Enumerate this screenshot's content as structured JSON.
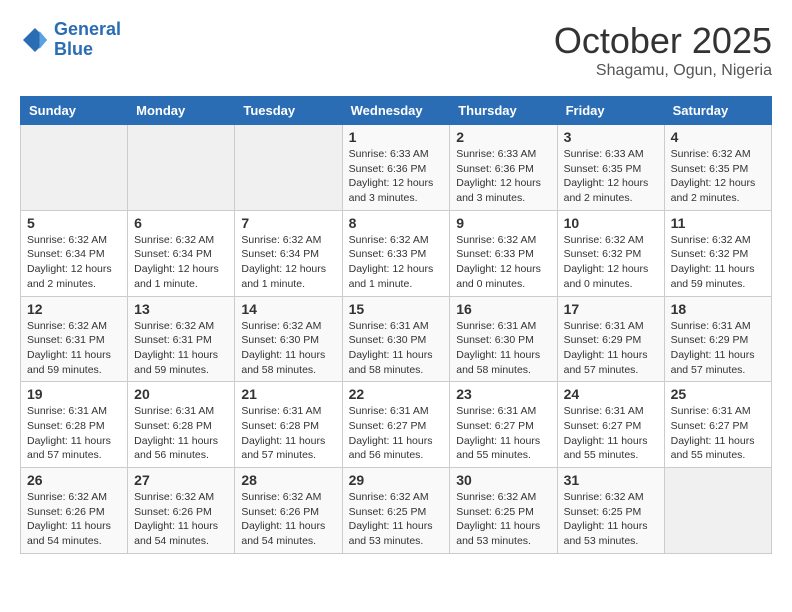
{
  "header": {
    "logo_line1": "General",
    "logo_line2": "Blue",
    "month": "October 2025",
    "location": "Shagamu, Ogun, Nigeria"
  },
  "days_of_week": [
    "Sunday",
    "Monday",
    "Tuesday",
    "Wednesday",
    "Thursday",
    "Friday",
    "Saturday"
  ],
  "weeks": [
    [
      {
        "num": "",
        "info": ""
      },
      {
        "num": "",
        "info": ""
      },
      {
        "num": "",
        "info": ""
      },
      {
        "num": "1",
        "info": "Sunrise: 6:33 AM\nSunset: 6:36 PM\nDaylight: 12 hours and 3 minutes."
      },
      {
        "num": "2",
        "info": "Sunrise: 6:33 AM\nSunset: 6:36 PM\nDaylight: 12 hours and 3 minutes."
      },
      {
        "num": "3",
        "info": "Sunrise: 6:33 AM\nSunset: 6:35 PM\nDaylight: 12 hours and 2 minutes."
      },
      {
        "num": "4",
        "info": "Sunrise: 6:32 AM\nSunset: 6:35 PM\nDaylight: 12 hours and 2 minutes."
      }
    ],
    [
      {
        "num": "5",
        "info": "Sunrise: 6:32 AM\nSunset: 6:34 PM\nDaylight: 12 hours and 2 minutes."
      },
      {
        "num": "6",
        "info": "Sunrise: 6:32 AM\nSunset: 6:34 PM\nDaylight: 12 hours and 1 minute."
      },
      {
        "num": "7",
        "info": "Sunrise: 6:32 AM\nSunset: 6:34 PM\nDaylight: 12 hours and 1 minute."
      },
      {
        "num": "8",
        "info": "Sunrise: 6:32 AM\nSunset: 6:33 PM\nDaylight: 12 hours and 1 minute."
      },
      {
        "num": "9",
        "info": "Sunrise: 6:32 AM\nSunset: 6:33 PM\nDaylight: 12 hours and 0 minutes."
      },
      {
        "num": "10",
        "info": "Sunrise: 6:32 AM\nSunset: 6:32 PM\nDaylight: 12 hours and 0 minutes."
      },
      {
        "num": "11",
        "info": "Sunrise: 6:32 AM\nSunset: 6:32 PM\nDaylight: 11 hours and 59 minutes."
      }
    ],
    [
      {
        "num": "12",
        "info": "Sunrise: 6:32 AM\nSunset: 6:31 PM\nDaylight: 11 hours and 59 minutes."
      },
      {
        "num": "13",
        "info": "Sunrise: 6:32 AM\nSunset: 6:31 PM\nDaylight: 11 hours and 59 minutes."
      },
      {
        "num": "14",
        "info": "Sunrise: 6:32 AM\nSunset: 6:30 PM\nDaylight: 11 hours and 58 minutes."
      },
      {
        "num": "15",
        "info": "Sunrise: 6:31 AM\nSunset: 6:30 PM\nDaylight: 11 hours and 58 minutes."
      },
      {
        "num": "16",
        "info": "Sunrise: 6:31 AM\nSunset: 6:30 PM\nDaylight: 11 hours and 58 minutes."
      },
      {
        "num": "17",
        "info": "Sunrise: 6:31 AM\nSunset: 6:29 PM\nDaylight: 11 hours and 57 minutes."
      },
      {
        "num": "18",
        "info": "Sunrise: 6:31 AM\nSunset: 6:29 PM\nDaylight: 11 hours and 57 minutes."
      }
    ],
    [
      {
        "num": "19",
        "info": "Sunrise: 6:31 AM\nSunset: 6:28 PM\nDaylight: 11 hours and 57 minutes."
      },
      {
        "num": "20",
        "info": "Sunrise: 6:31 AM\nSunset: 6:28 PM\nDaylight: 11 hours and 56 minutes."
      },
      {
        "num": "21",
        "info": "Sunrise: 6:31 AM\nSunset: 6:28 PM\nDaylight: 11 hours and 57 minutes."
      },
      {
        "num": "22",
        "info": "Sunrise: 6:31 AM\nSunset: 6:27 PM\nDaylight: 11 hours and 56 minutes."
      },
      {
        "num": "23",
        "info": "Sunrise: 6:31 AM\nSunset: 6:27 PM\nDaylight: 11 hours and 55 minutes."
      },
      {
        "num": "24",
        "info": "Sunrise: 6:31 AM\nSunset: 6:27 PM\nDaylight: 11 hours and 55 minutes."
      },
      {
        "num": "25",
        "info": "Sunrise: 6:31 AM\nSunset: 6:27 PM\nDaylight: 11 hours and 55 minutes."
      }
    ],
    [
      {
        "num": "26",
        "info": "Sunrise: 6:32 AM\nSunset: 6:26 PM\nDaylight: 11 hours and 54 minutes."
      },
      {
        "num": "27",
        "info": "Sunrise: 6:32 AM\nSunset: 6:26 PM\nDaylight: 11 hours and 54 minutes."
      },
      {
        "num": "28",
        "info": "Sunrise: 6:32 AM\nSunset: 6:26 PM\nDaylight: 11 hours and 54 minutes."
      },
      {
        "num": "29",
        "info": "Sunrise: 6:32 AM\nSunset: 6:25 PM\nDaylight: 11 hours and 53 minutes."
      },
      {
        "num": "30",
        "info": "Sunrise: 6:32 AM\nSunset: 6:25 PM\nDaylight: 11 hours and 53 minutes."
      },
      {
        "num": "31",
        "info": "Sunrise: 6:32 AM\nSunset: 6:25 PM\nDaylight: 11 hours and 53 minutes."
      },
      {
        "num": "",
        "info": ""
      }
    ]
  ]
}
